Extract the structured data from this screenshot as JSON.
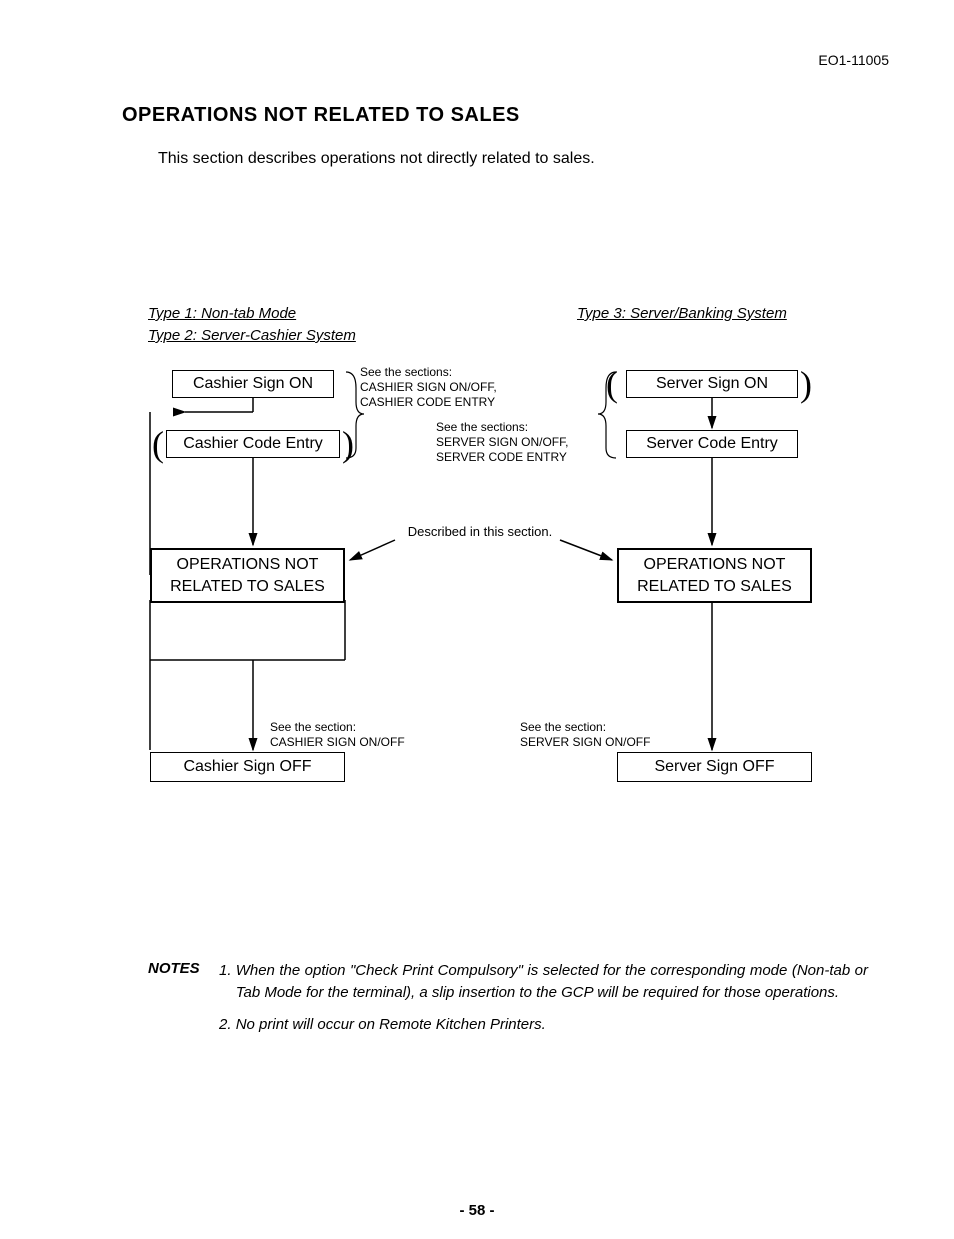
{
  "doc_id": "EO1-11005",
  "section_title": "OPERATIONS NOT RELATED TO SALES",
  "intro": "This section describes operations not directly related to sales.",
  "types": {
    "t1": "Type 1: Non-tab Mode",
    "t2": "Type 2: Server-Cashier System",
    "t3": "Type 3: Server/Banking System"
  },
  "boxes": {
    "cashier_sign_on": "Cashier Sign ON",
    "cashier_code_entry": "Cashier Code Entry",
    "ops_left": "OPERATIONS NOT\nRELATED TO SALES",
    "cashier_sign_off": "Cashier Sign OFF",
    "server_sign_on": "Server Sign ON",
    "server_code_entry": "Server Code Entry",
    "ops_right": "OPERATIONS NOT\nRELATED TO SALES",
    "server_sign_off": "Server Sign OFF"
  },
  "annot": {
    "see_cashier": "See the sections:\nCASHIER SIGN ON/OFF,\nCASHIER CODE ENTRY",
    "see_server": "See the sections:\nSERVER SIGN ON/OFF,\nSERVER CODE ENTRY",
    "described": "Described in this section.",
    "see_cashier_off": "See the section:\nCASHIER SIGN ON/OFF",
    "see_server_off": "See the section:\nSERVER SIGN ON/OFF"
  },
  "notes_label": "NOTES",
  "notes": [
    "When the option \"Check Print Compulsory\" is selected for the corresponding mode (Non-tab or Tab Mode for the terminal), a slip insertion to the GCP will be required for those operations.",
    "No print will occur on Remote Kitchen Printers."
  ],
  "page_number": "- 58 -"
}
